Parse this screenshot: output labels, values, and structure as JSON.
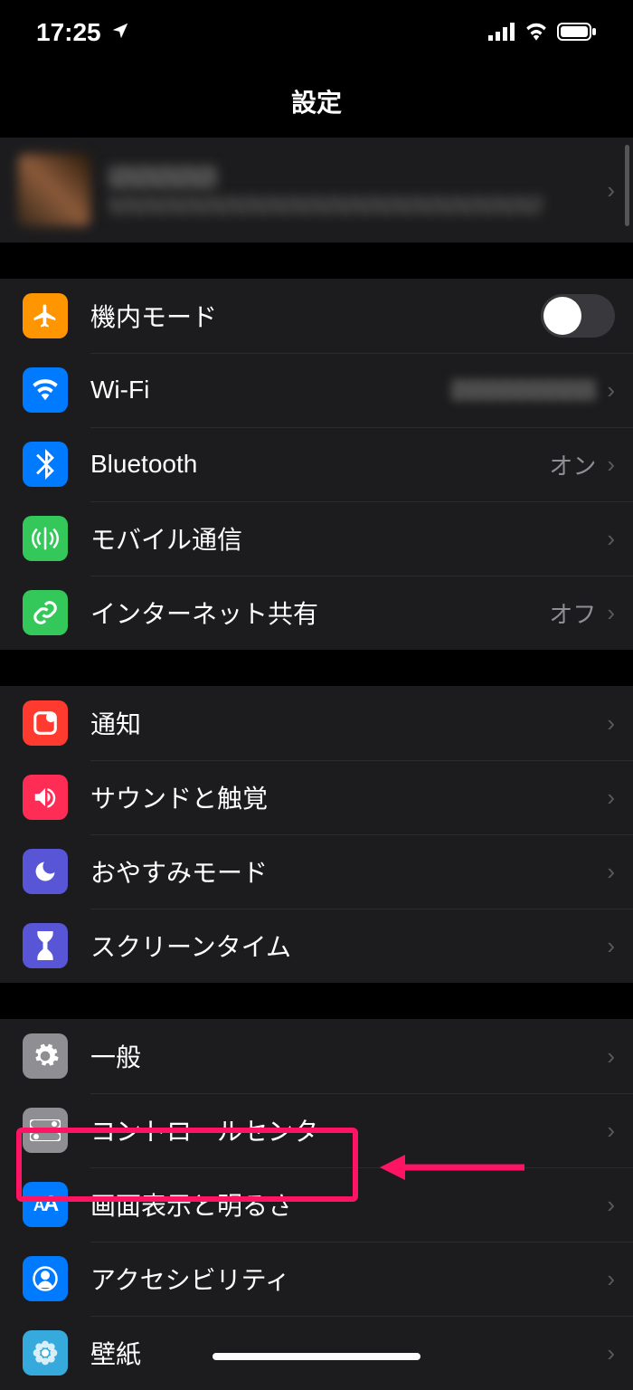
{
  "status": {
    "time": "17:25"
  },
  "header": {
    "title": "設定"
  },
  "groups": [
    {
      "rows": [
        {
          "id": "airplane",
          "label": "機内モード",
          "icon": "airplane",
          "iconBg": "#ff9500",
          "type": "toggle"
        },
        {
          "id": "wifi",
          "label": "Wi-Fi",
          "icon": "wifi",
          "iconBg": "#007aff",
          "type": "nav",
          "valueBlurred": true
        },
        {
          "id": "bluetooth",
          "label": "Bluetooth",
          "icon": "bluetooth",
          "iconBg": "#007aff",
          "type": "nav",
          "value": "オン"
        },
        {
          "id": "cellular",
          "label": "モバイル通信",
          "icon": "antenna",
          "iconBg": "#34c759",
          "type": "nav"
        },
        {
          "id": "hotspot",
          "label": "インターネット共有",
          "icon": "link",
          "iconBg": "#34c759",
          "type": "nav",
          "value": "オフ"
        }
      ]
    },
    {
      "rows": [
        {
          "id": "notifications",
          "label": "通知",
          "icon": "notify",
          "iconBg": "#ff3b30",
          "type": "nav"
        },
        {
          "id": "sounds",
          "label": "サウンドと触覚",
          "icon": "speaker",
          "iconBg": "#ff2d55",
          "type": "nav"
        },
        {
          "id": "dnd",
          "label": "おやすみモード",
          "icon": "moon",
          "iconBg": "#5856d6",
          "type": "nav"
        },
        {
          "id": "screentime",
          "label": "スクリーンタイム",
          "icon": "hourglass",
          "iconBg": "#5856d6",
          "type": "nav"
        }
      ]
    },
    {
      "rows": [
        {
          "id": "general",
          "label": "一般",
          "icon": "gear",
          "iconBg": "#8e8e93",
          "type": "nav"
        },
        {
          "id": "controlcenter",
          "label": "コントロールセンター",
          "icon": "switches",
          "iconBg": "#8e8e93",
          "type": "nav"
        },
        {
          "id": "display",
          "label": "画面表示と明るさ",
          "icon": "AA",
          "iconBg": "#007aff",
          "type": "nav",
          "highlighted": true
        },
        {
          "id": "accessibility",
          "label": "アクセシビリティ",
          "icon": "person",
          "iconBg": "#007aff",
          "type": "nav"
        },
        {
          "id": "wallpaper",
          "label": "壁紙",
          "icon": "flower",
          "iconBg": "#37aadd",
          "type": "nav"
        }
      ]
    }
  ]
}
